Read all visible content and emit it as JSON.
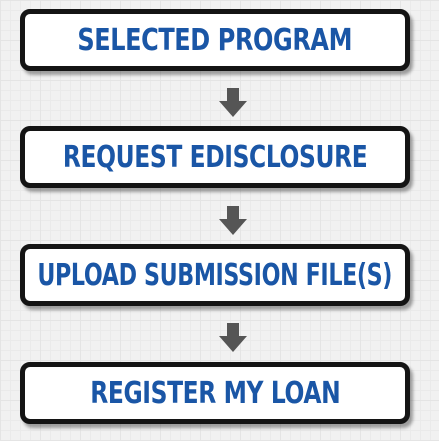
{
  "flowchart": {
    "steps": [
      {
        "label": "SELECTED PROGRAM"
      },
      {
        "label": "REQUEST EDISCLOSURE"
      },
      {
        "label": "UPLOAD SUBMISSION FILE(S)"
      },
      {
        "label": "REGISTER MY LOAN"
      }
    ],
    "arrow_icon": "arrow-down-icon",
    "colors": {
      "label_text": "#1a56a6",
      "box_border": "#141414",
      "box_fill": "#ffffff",
      "arrow": "#555555",
      "background": "#f1f1f1"
    }
  }
}
